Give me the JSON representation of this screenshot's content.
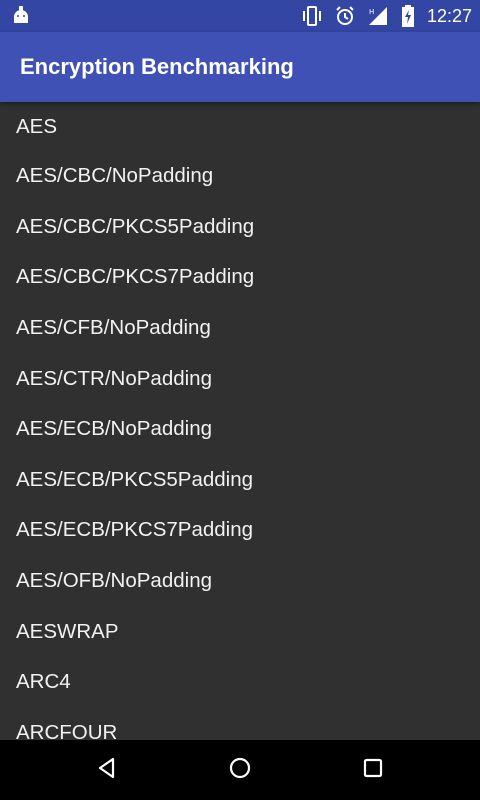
{
  "status_bar": {
    "time": "12:27",
    "icons": [
      "android-debug-icon",
      "vibrate-icon",
      "alarm-icon",
      "signal-icon",
      "battery-charging-icon"
    ]
  },
  "app_bar": {
    "title": "Encryption Benchmarking",
    "color": "#3f51b5"
  },
  "list": {
    "items": [
      "AES",
      "AES/CBC/NoPadding",
      "AES/CBC/PKCS5Padding",
      "AES/CBC/PKCS7Padding",
      "AES/CFB/NoPadding",
      "AES/CTR/NoPadding",
      "AES/ECB/NoPadding",
      "AES/ECB/PKCS5Padding",
      "AES/ECB/PKCS7Padding",
      "AES/OFB/NoPadding",
      "AESWRAP",
      "ARC4",
      "ARCFOUR"
    ]
  },
  "nav_bar": {
    "buttons": [
      "back-icon",
      "home-icon",
      "recents-icon"
    ]
  }
}
